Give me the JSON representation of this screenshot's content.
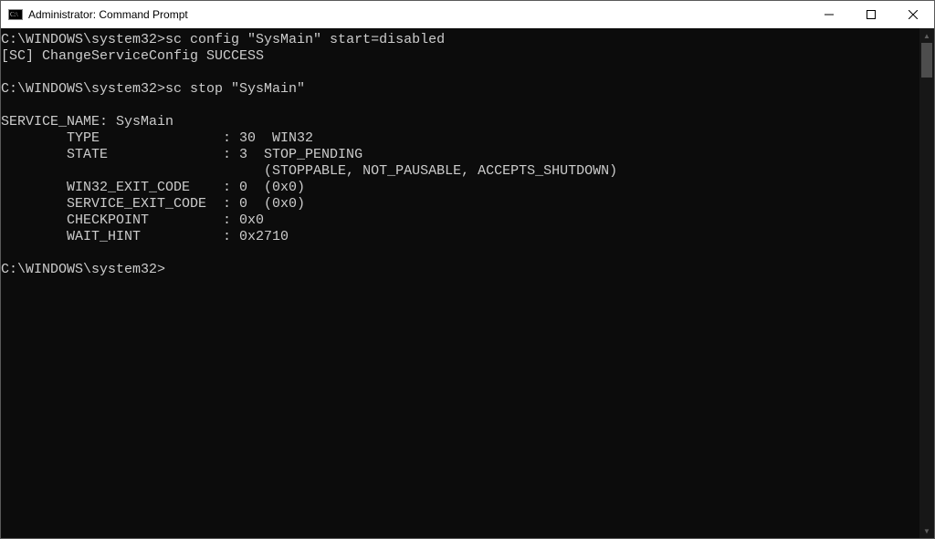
{
  "titlebar": {
    "title": "Administrator: Command Prompt"
  },
  "console": {
    "prompt1": "C:\\WINDOWS\\system32>",
    "cmd1": "sc config \"SysMain\" start=disabled",
    "resp1": "[SC] ChangeServiceConfig SUCCESS",
    "prompt2": "C:\\WINDOWS\\system32>",
    "cmd2": "sc stop \"SysMain\"",
    "svc_name_line": "SERVICE_NAME: SysMain",
    "type_line": "        TYPE               : 30  WIN32",
    "state_line": "        STATE              : 3  STOP_PENDING",
    "state_flags": "                                (STOPPABLE, NOT_PAUSABLE, ACCEPTS_SHUTDOWN)",
    "w32_exit": "        WIN32_EXIT_CODE    : 0  (0x0)",
    "svc_exit": "        SERVICE_EXIT_CODE  : 0  (0x0)",
    "checkpoint": "        CHECKPOINT         : 0x0",
    "wait_hint": "        WAIT_HINT          : 0x2710",
    "prompt3": "C:\\WINDOWS\\system32>"
  }
}
